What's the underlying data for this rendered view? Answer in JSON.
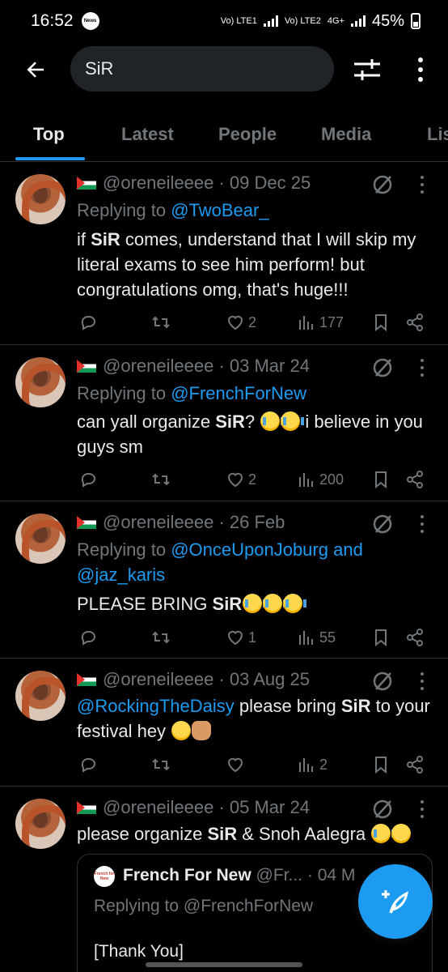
{
  "status_bar": {
    "time": "16:52",
    "news_badge": "News",
    "lte1": "Vo) LTE1",
    "lte2": "Vo) LTE2",
    "net": "4G+",
    "battery": "45%"
  },
  "search": {
    "query": "SiR"
  },
  "tabs": [
    "Top",
    "Latest",
    "People",
    "Media",
    "Lis"
  ],
  "tweets": [
    {
      "handle": "@oreneileeee",
      "date": "09 Dec 25",
      "reply_prefix": "Replying to",
      "reply_to": "@TwoBear_",
      "text_before": "if ",
      "bold": "SiR",
      "text_after": " comes, understand that I will skip my literal exams to see him perform! but congratulations omg, that's huge!!!",
      "likes": "2",
      "views": "177"
    },
    {
      "handle": "@oreneileeee",
      "date": "03 Mar 24",
      "reply_prefix": "Replying to",
      "reply_to": "@FrenchForNew",
      "text_before": "can yall organize ",
      "bold": "SiR",
      "text_mid": "? ",
      "text_after": " i believe in you guys sm",
      "likes": "2",
      "views": "200"
    },
    {
      "handle": "@oreneileeee",
      "date": "26 Feb",
      "reply_prefix": "Replying to",
      "reply_to": "@OnceUponJoburg and",
      "reply_to_2": "@jaz_karis",
      "text_before": "PLEASE BRING ",
      "bold": "SiR",
      "likes": "1",
      "views": "55"
    },
    {
      "handle": "@oreneileeee",
      "date": "03 Aug 25",
      "mention": "@RockingTheDaisy",
      "text_before": " please bring ",
      "bold": "SiR",
      "text_after": " to your festival hey ",
      "likes": "",
      "views": "2"
    },
    {
      "handle": "@oreneileeee",
      "date": "05 Mar 24",
      "text_before": "please organize ",
      "bold": "SiR",
      "text_after": " & Snoh Aalegra ",
      "quote": {
        "avatar_text": "French for New",
        "name": "French For New",
        "handle_date": "@Fr... · 04 M",
        "reply": "Replying to @FrenchForNew",
        "text": "[Thank You]"
      }
    }
  ],
  "colors": {
    "accent": "#1d9bf0",
    "muted": "#71767b",
    "text": "#e7e9ea",
    "background": "#000000"
  }
}
